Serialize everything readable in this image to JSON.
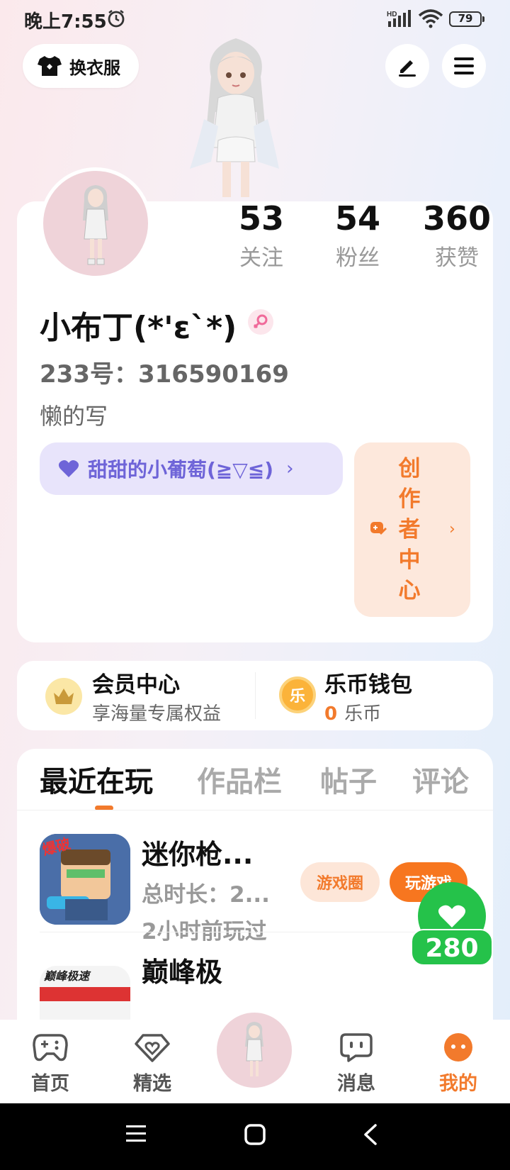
{
  "status_bar": {
    "time": "晚上7:55",
    "battery": "79",
    "network": "HD"
  },
  "header": {
    "outfit_label": "换衣服"
  },
  "profile": {
    "stats": [
      {
        "value": "53",
        "label": "关注"
      },
      {
        "value": "54",
        "label": "粉丝"
      },
      {
        "value": "360",
        "label": "获赞"
      }
    ],
    "nickname": "小布丁(*'ε`*)",
    "user_id": "233号：316590169",
    "bio": "懒的写",
    "group_label": "甜甜的小葡萄(≧▽≦)",
    "group_chevron": "›",
    "creator_center": "创作者中心",
    "creator_arrow": "›"
  },
  "vip": {
    "title": "会员中心",
    "subtitle": "享海量专属权益"
  },
  "wallet": {
    "title": "乐币钱包",
    "count": "0",
    "unit": "乐币",
    "coin_glyph": "乐"
  },
  "tabs": [
    "最近在玩",
    "作品栏",
    "帖子",
    "评论"
  ],
  "games": [
    {
      "title": "迷你枪...",
      "duration": "总时长：2...",
      "last_played": "2小时前玩过",
      "circle_btn": "游戏圈",
      "play_btn": "玩游戏",
      "thumb_badge": "爆破"
    },
    {
      "title": "巅峰极",
      "thumb_badge": "巅峰极速"
    }
  ],
  "like": {
    "count": "280"
  },
  "bottom_nav": [
    {
      "label": "首页",
      "icon": "gamepad-icon"
    },
    {
      "label": "精选",
      "icon": "heart-diamond-icon"
    },
    {
      "label": "",
      "icon": "avatar"
    },
    {
      "label": "消息",
      "icon": "chat-icon"
    },
    {
      "label": "我的",
      "icon": "face-icon"
    }
  ],
  "colors": {
    "accent": "#f27a2c",
    "group": "#6e64d8",
    "like": "#25c24a"
  }
}
